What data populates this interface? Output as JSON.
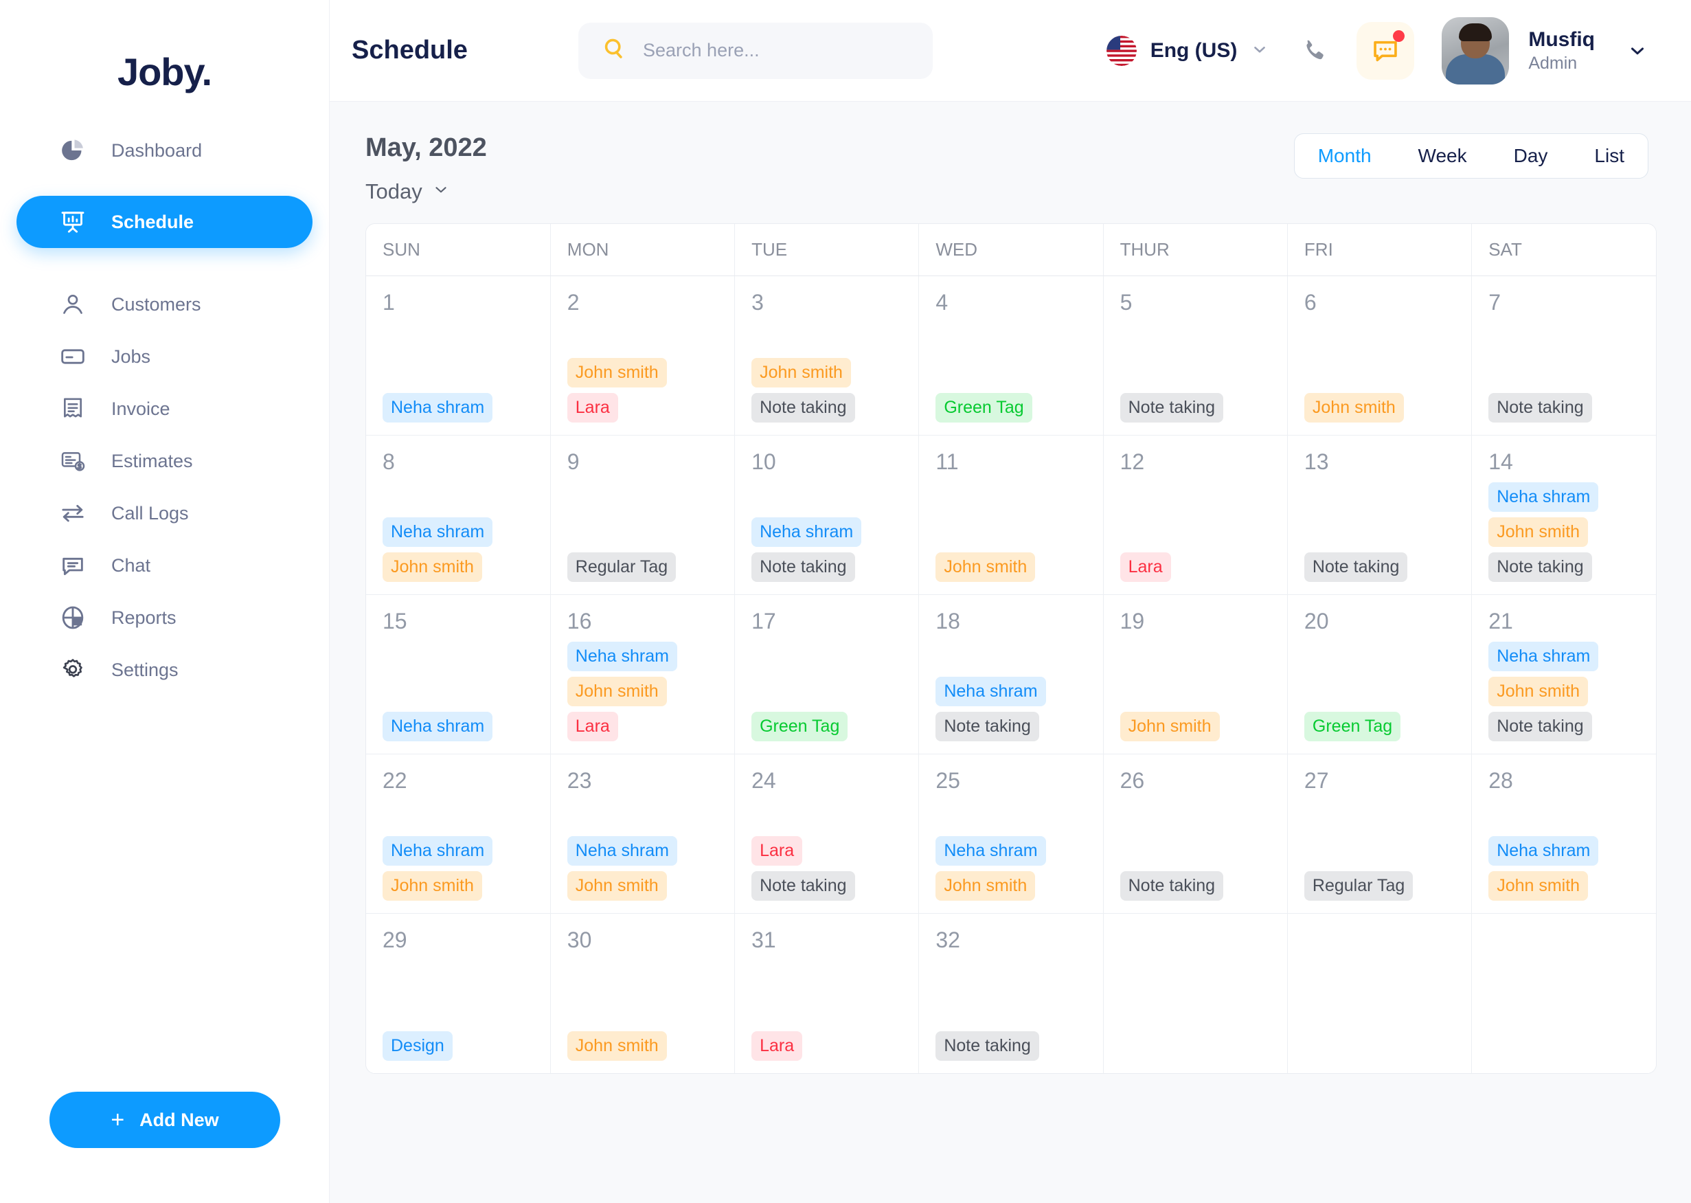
{
  "brand": {
    "name": "Joby."
  },
  "sidebar": {
    "items": [
      {
        "label": "Dashboard",
        "icon": "pie-chart-icon",
        "active": false
      },
      {
        "label": "Schedule",
        "icon": "presentation-chart-icon",
        "active": true
      },
      {
        "label": "Customers",
        "icon": "user-icon",
        "active": false
      },
      {
        "label": "Jobs",
        "icon": "card-icon",
        "active": false
      },
      {
        "label": "Invoice",
        "icon": "receipt-icon",
        "active": false
      },
      {
        "label": "Estimates",
        "icon": "estimate-dollar-icon",
        "active": false
      },
      {
        "label": "Call Logs",
        "icon": "transfer-arrows-icon",
        "active": false
      },
      {
        "label": "Chat",
        "icon": "chat-bubble-icon",
        "active": false
      },
      {
        "label": "Reports",
        "icon": "report-circle-icon",
        "active": false
      },
      {
        "label": "Settings",
        "icon": "gear-icon",
        "active": false
      }
    ],
    "add_new_label": "Add New",
    "add_new_icon": "plus-icon"
  },
  "topbar": {
    "title": "Schedule",
    "search_placeholder": "Search here...",
    "search_value": "",
    "search_icon": "search-icon",
    "language": "Eng (US)",
    "language_flag": "us-flag-icon",
    "phone_icon": "phone-icon",
    "message_icon": "message-icon",
    "message_has_badge": true,
    "user_name": "Musfiq",
    "user_role": "Admin",
    "user_avatar": "avatar",
    "dropdown_icon": "chevron-down-icon"
  },
  "calendar": {
    "month_title": "May, 2022",
    "today_label": "Today",
    "today_icon": "chevron-down-icon",
    "views": [
      {
        "label": "Month",
        "active": true
      },
      {
        "label": "Week",
        "active": false
      },
      {
        "label": "Day",
        "active": false
      },
      {
        "label": "List",
        "active": false
      }
    ],
    "weekdays": [
      "SUN",
      "MON",
      "TUE",
      "WED",
      "THUR",
      "FRI",
      "SAT"
    ],
    "tag_colors": {
      "blue": "#128cf7",
      "blue_bg": "#dcefff",
      "orange": "#fb9a21",
      "orange_bg": "#ffeccf",
      "red": "#fb2f41",
      "red_bg": "#ffe4e7",
      "green": "#07ca31",
      "green_bg": "#d8f8df",
      "gray": "#4a4f59",
      "gray_bg": "#e6e7e9"
    },
    "weeks": [
      [
        {
          "day": "1",
          "events": [
            {
              "label": "Neha shram",
              "color": "blue"
            }
          ]
        },
        {
          "day": "2",
          "events": [
            {
              "label": "John smith",
              "color": "orange"
            },
            {
              "label": "Lara",
              "color": "red"
            }
          ]
        },
        {
          "day": "3",
          "events": [
            {
              "label": "John smith",
              "color": "orange"
            },
            {
              "label": "Note taking",
              "color": "gray"
            }
          ]
        },
        {
          "day": "4",
          "events": [
            {
              "label": "Green Tag",
              "color": "green"
            }
          ]
        },
        {
          "day": "5",
          "events": [
            {
              "label": "Note taking",
              "color": "gray"
            }
          ]
        },
        {
          "day": "6",
          "events": [
            {
              "label": "John smith",
              "color": "orange"
            }
          ]
        },
        {
          "day": "7",
          "events": [
            {
              "label": "Note taking",
              "color": "gray"
            }
          ]
        }
      ],
      [
        {
          "day": "8",
          "events": [
            {
              "label": "Neha shram",
              "color": "blue"
            },
            {
              "label": "John smith",
              "color": "orange"
            }
          ]
        },
        {
          "day": "9",
          "events": [
            {
              "label": "Regular Tag",
              "color": "gray"
            }
          ]
        },
        {
          "day": "10",
          "events": [
            {
              "label": "Neha shram",
              "color": "blue"
            },
            {
              "label": "Note taking",
              "color": "gray"
            }
          ]
        },
        {
          "day": "11",
          "events": [
            {
              "label": "John smith",
              "color": "orange"
            }
          ]
        },
        {
          "day": "12",
          "events": [
            {
              "label": "Lara",
              "color": "red"
            }
          ]
        },
        {
          "day": "13",
          "events": [
            {
              "label": "Note taking",
              "color": "gray"
            }
          ]
        },
        {
          "day": "14",
          "events": [
            {
              "label": "Neha shram",
              "color": "blue"
            },
            {
              "label": "John smith",
              "color": "orange"
            },
            {
              "label": "Note taking",
              "color": "gray"
            }
          ]
        }
      ],
      [
        {
          "day": "15",
          "events": [
            {
              "label": "Neha shram",
              "color": "blue"
            }
          ]
        },
        {
          "day": "16",
          "events": [
            {
              "label": "Neha shram",
              "color": "blue"
            },
            {
              "label": "John smith",
              "color": "orange"
            },
            {
              "label": "Lara",
              "color": "red"
            }
          ]
        },
        {
          "day": "17",
          "events": [
            {
              "label": "Green Tag",
              "color": "green"
            }
          ]
        },
        {
          "day": "18",
          "events": [
            {
              "label": "Neha shram",
              "color": "blue"
            },
            {
              "label": "Note taking",
              "color": "gray"
            }
          ]
        },
        {
          "day": "19",
          "events": [
            {
              "label": "John smith",
              "color": "orange"
            }
          ]
        },
        {
          "day": "20",
          "events": [
            {
              "label": "Green Tag",
              "color": "green"
            }
          ]
        },
        {
          "day": "21",
          "events": [
            {
              "label": "Neha shram",
              "color": "blue"
            },
            {
              "label": "John smith",
              "color": "orange"
            },
            {
              "label": "Note taking",
              "color": "gray"
            }
          ]
        }
      ],
      [
        {
          "day": "22",
          "events": [
            {
              "label": "Neha shram",
              "color": "blue"
            },
            {
              "label": "John smith",
              "color": "orange"
            }
          ]
        },
        {
          "day": "23",
          "events": [
            {
              "label": "Neha shram",
              "color": "blue"
            },
            {
              "label": "John smith",
              "color": "orange"
            }
          ]
        },
        {
          "day": "24",
          "events": [
            {
              "label": "Lara",
              "color": "red"
            },
            {
              "label": "Note taking",
              "color": "gray"
            }
          ]
        },
        {
          "day": "25",
          "events": [
            {
              "label": "Neha shram",
              "color": "blue"
            },
            {
              "label": "John smith",
              "color": "orange"
            }
          ]
        },
        {
          "day": "26",
          "events": [
            {
              "label": "Note taking",
              "color": "gray"
            }
          ]
        },
        {
          "day": "27",
          "events": [
            {
              "label": "Regular Tag",
              "color": "gray"
            }
          ]
        },
        {
          "day": "28",
          "events": [
            {
              "label": "Neha shram",
              "color": "blue"
            },
            {
              "label": "John smith",
              "color": "orange"
            }
          ]
        }
      ],
      [
        {
          "day": "29",
          "events": [
            {
              "label": "Design",
              "color": "blue"
            }
          ]
        },
        {
          "day": "30",
          "events": [
            {
              "label": "John smith",
              "color": "orange"
            }
          ]
        },
        {
          "day": "31",
          "events": [
            {
              "label": "Lara",
              "color": "red"
            }
          ]
        },
        {
          "day": "32",
          "events": [
            {
              "label": "Note taking",
              "color": "gray"
            }
          ]
        },
        {
          "day": "",
          "empty": true
        },
        {
          "day": "",
          "empty": true
        },
        {
          "day": "",
          "empty": true
        }
      ]
    ]
  }
}
